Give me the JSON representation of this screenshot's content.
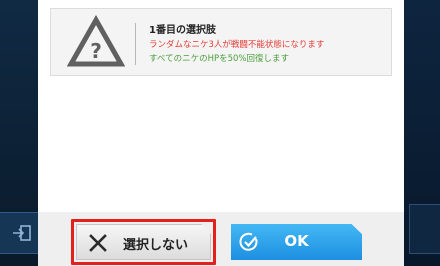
{
  "option": {
    "title": "1番目の選択肢",
    "line1": "ランダムなニケ3人が戦闘不能状態になります",
    "line2": "すべてのニケのHPを50%回復します",
    "icon": "warning-question-icon"
  },
  "buttons": {
    "cancel_label": "選択しない",
    "ok_label": "OK"
  },
  "colors": {
    "negative_text": "#e53b34",
    "positive_text": "#4a9e3a",
    "ok_button": "#2aa0ea",
    "highlight_frame": "#e4201d"
  }
}
